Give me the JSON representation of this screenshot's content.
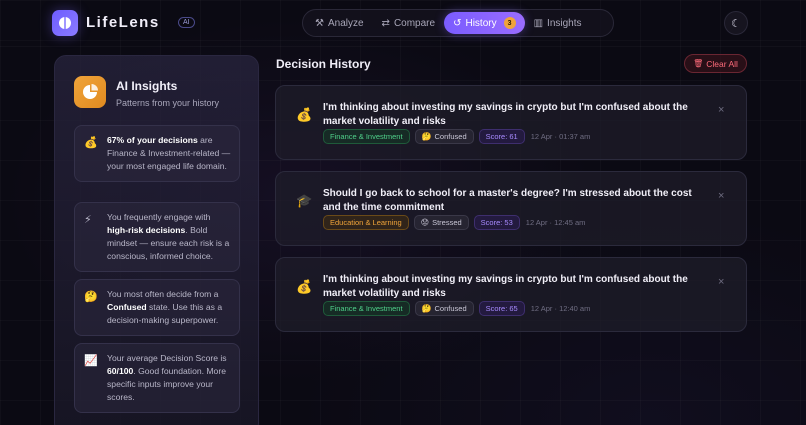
{
  "header": {
    "brand": "LifeLens",
    "ai_chip": "AI",
    "nav": [
      {
        "label": "Analyze",
        "icon": "magic-wand-icon",
        "glyph": "⚒"
      },
      {
        "label": "Compare",
        "icon": "compare-icon",
        "glyph": "⇄"
      },
      {
        "label": "History",
        "icon": "history-icon",
        "glyph": "↺",
        "badge": "3"
      },
      {
        "label": "Insights",
        "icon": "bar-chart-icon",
        "glyph": "▥"
      }
    ],
    "theme_glyph": "☾"
  },
  "sidebar": {
    "title": "AI Insights",
    "subtitle": "Patterns from your history",
    "cards": [
      {
        "emoji": "💰",
        "strong": "67% of your decisions",
        "text": " are Finance & Investment-related — your most engaged life domain."
      },
      {
        "emoji": "⚡",
        "pre": "You frequently engage with ",
        "strong": "high-risk decisions",
        "text": ". Bold mindset — ensure each risk is a conscious, informed choice."
      },
      {
        "emoji": "🤔",
        "pre": "You most often decide from a ",
        "strong": "Confused",
        "text": " state. Use this as a decision-making superpower."
      },
      {
        "emoji": "📈",
        "pre": "Your average Decision Score is ",
        "strong": "60/100",
        "text": ". Good foundation. More specific inputs improve your scores."
      }
    ]
  },
  "main": {
    "title": "Decision History",
    "clear_label": "Clear All",
    "clear_glyph": "🗑",
    "items": [
      {
        "emoji": "💰",
        "question": "I'm thinking about investing my savings in crypto but I'm confused about the market volatility and risks",
        "category": "Finance & Investment",
        "mood_emoji": "🤔",
        "mood": "Confused",
        "score": "Score: 61",
        "time": "12 Apr · 01:37 am"
      },
      {
        "emoji": "🎓",
        "question": "Should I go back to school for a master's degree? I'm stressed about the cost and the time commitment",
        "category": "Education & Learning",
        "mood_emoji": "😟",
        "mood": "Stressed",
        "score": "Score: 53",
        "time": "12 Apr · 12:45 am"
      },
      {
        "emoji": "💰",
        "question": "I'm thinking about investing my savings in crypto but I'm confused about the market volatility and risks",
        "category": "Finance & Investment",
        "mood_emoji": "🤔",
        "mood": "Confused",
        "score": "Score: 65",
        "time": "12 Apr · 12:40 am"
      }
    ],
    "close_glyph": "×"
  }
}
